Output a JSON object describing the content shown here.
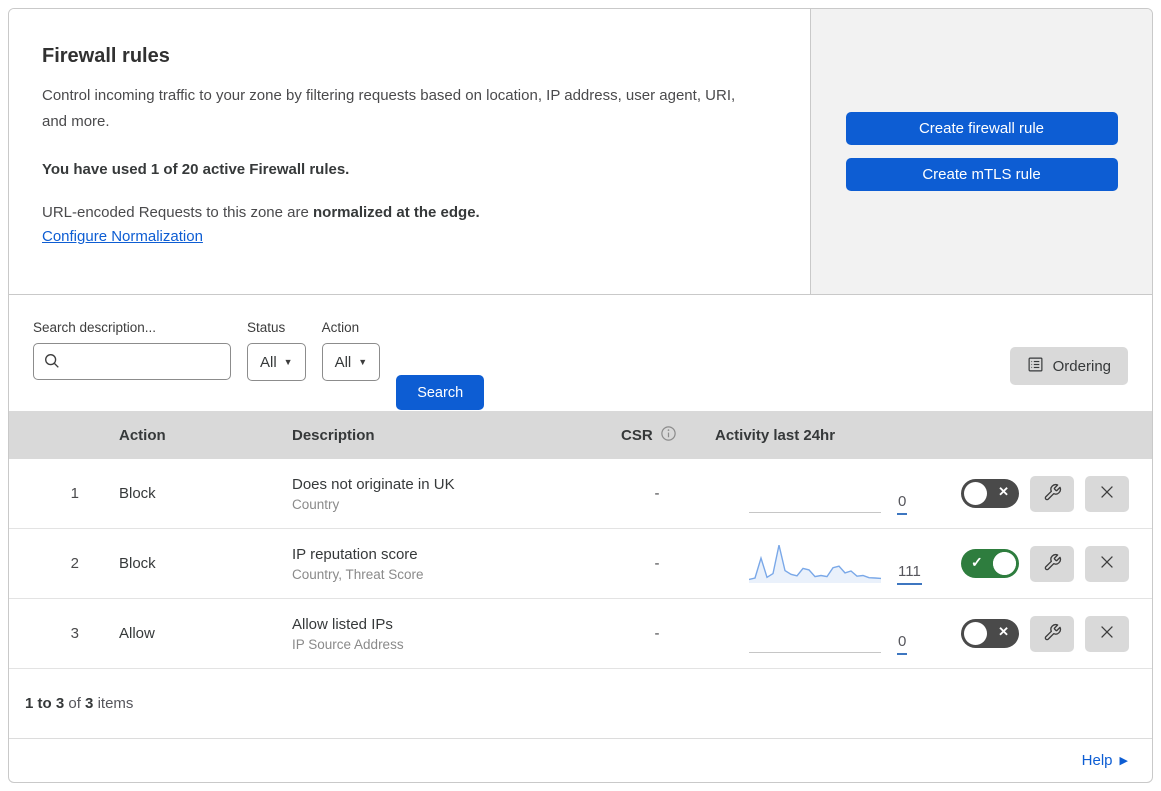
{
  "header": {
    "title": "Firewall rules",
    "description": "Control incoming traffic to your zone by filtering requests based on location, IP address, user agent, URI, and more.",
    "usage_note": "You have used 1 of 20 active Firewall rules.",
    "normalization_prefix": "URL-encoded Requests to this zone are",
    "normalization_bold": "normalized at the edge.",
    "normalization_link": "Configure Normalization",
    "actions": {
      "create_firewall_rule": "Create firewall rule",
      "create_mtls_rule": "Create mTLS rule"
    }
  },
  "filters": {
    "search_label": "Search description...",
    "search_value": "",
    "status_label": "Status",
    "status_value": "All",
    "action_label": "Action",
    "action_value": "All",
    "search_button": "Search",
    "ordering_button": "Ordering"
  },
  "table": {
    "columns": {
      "action": "Action",
      "description": "Description",
      "csr": "CSR",
      "activity": "Activity last 24hr"
    },
    "rows": [
      {
        "num": "1",
        "action": "Block",
        "description": "Does not originate in UK",
        "fields": "Country",
        "csr": "-",
        "activity_count": "0",
        "enabled": false,
        "has_activity": false,
        "sparkline": []
      },
      {
        "num": "2",
        "action": "Block",
        "description": "IP reputation score",
        "fields": "Country, Threat Score",
        "csr": "-",
        "activity_count": "111",
        "enabled": true,
        "has_activity": true,
        "sparkline": [
          4,
          8,
          62,
          10,
          20,
          97,
          28,
          18,
          14,
          34,
          30,
          12,
          15,
          12,
          36,
          40,
          22,
          27,
          13,
          15,
          9,
          8,
          7
        ]
      },
      {
        "num": "3",
        "action": "Allow",
        "description": "Allow listed IPs",
        "fields": "IP Source Address",
        "csr": "-",
        "activity_count": "0",
        "enabled": false,
        "has_activity": false,
        "sparkline": []
      }
    ]
  },
  "footer": {
    "range": "1 to 3",
    "of_text": "of",
    "total": "3",
    "items_text": "items"
  },
  "help": {
    "label": "Help"
  },
  "colors": {
    "primary_blue": "#0d5dd3",
    "toggle_on_green": "#2e7d3e",
    "toggle_off_gray": "#4a4a4a",
    "sparkline_blue": "#7aa8e8",
    "panel_gray": "#f2f2f2",
    "header_gray": "#d9d9d9"
  }
}
